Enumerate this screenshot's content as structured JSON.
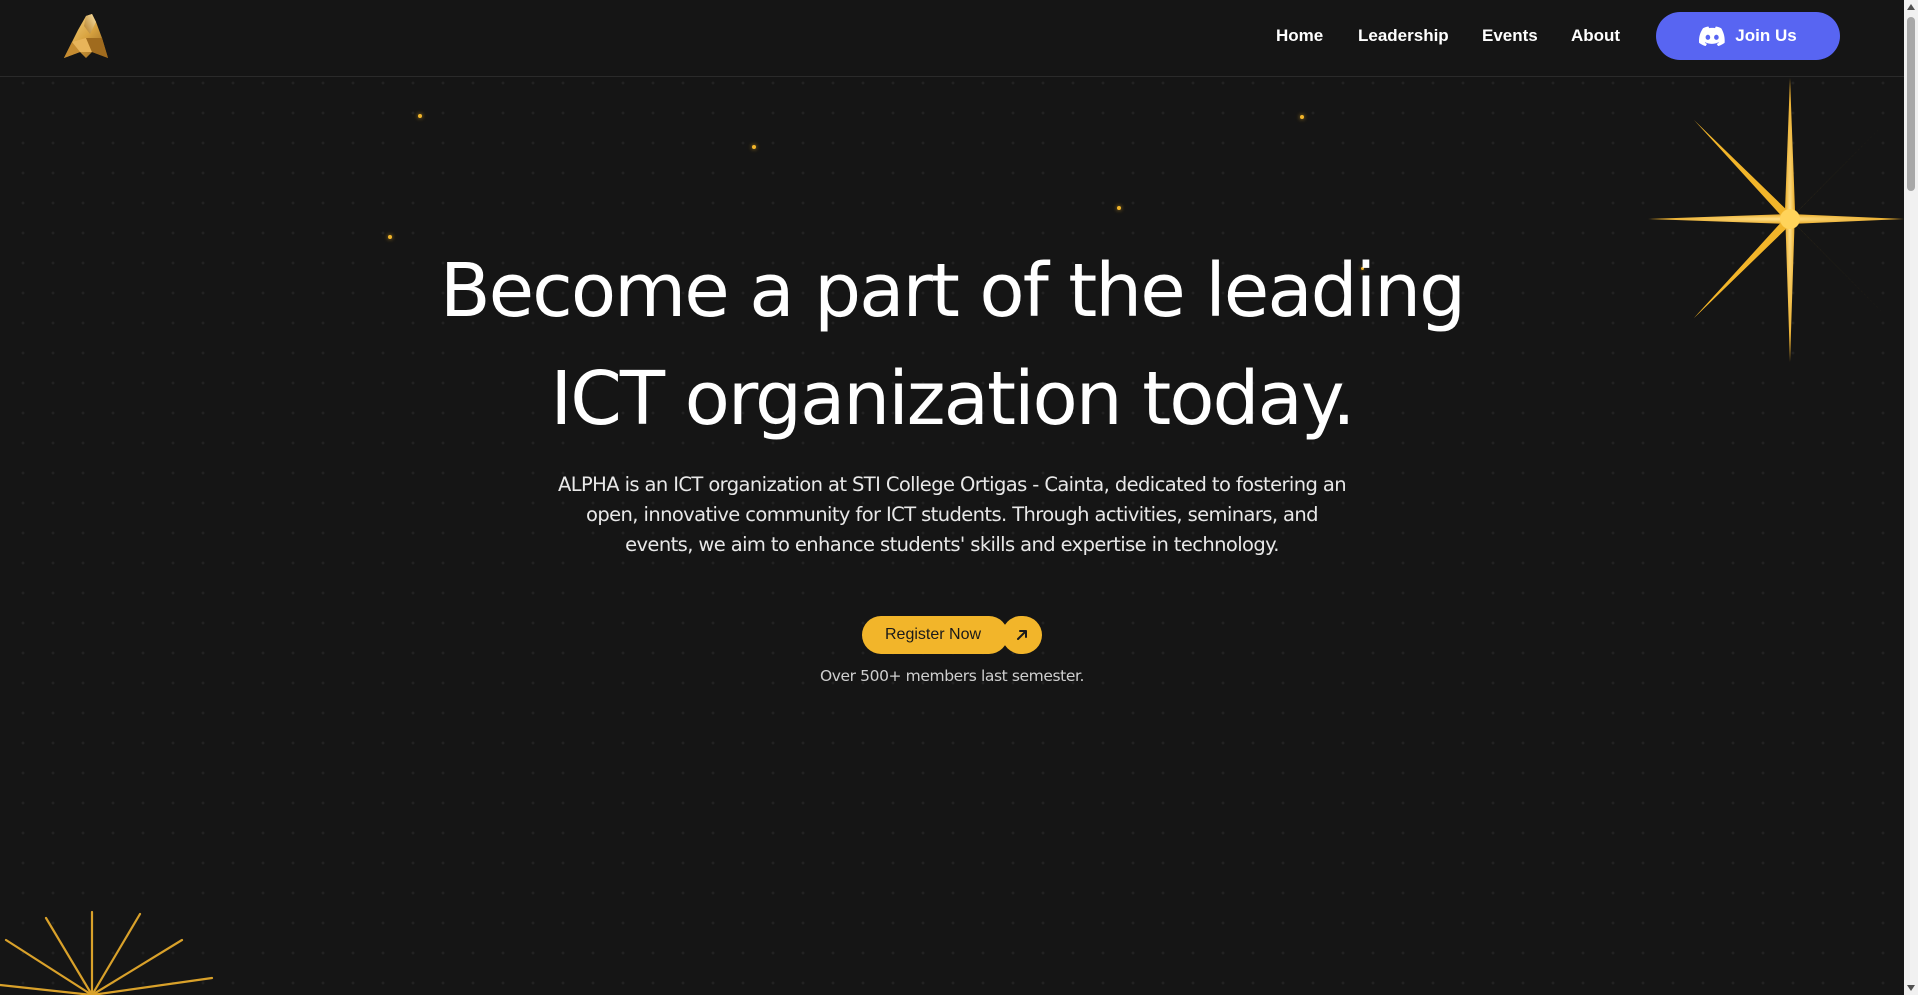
{
  "brand": {
    "logo_icon": "alpha-wolf-logo-icon",
    "accent_color": "#f2b52a",
    "discord_color": "#5865f2",
    "background_color": "#151515"
  },
  "nav": {
    "items": [
      {
        "label": "Home"
      },
      {
        "label": "Leadership"
      },
      {
        "label": "Events"
      },
      {
        "label": "About"
      }
    ],
    "join_label": "Join Us",
    "join_icon": "discord-icon"
  },
  "hero": {
    "title_line1": "Become a part of the leading",
    "title_line2": "ICT organization today.",
    "description": "ALPHA is an ICT organization at STI College Ortigas - Cainta, dedicated to fostering an open, innovative community for ICT students. Through activities, seminars, and events, we aim to enhance students' skills and expertise in technology.",
    "register_label": "Register Now",
    "register_icon": "arrow-up-right-icon",
    "members_note": "Over 500+ members last semester."
  },
  "decorations": {
    "big_star_icon": "sparkle-star-icon",
    "burst_icon": "starburst-icon"
  }
}
